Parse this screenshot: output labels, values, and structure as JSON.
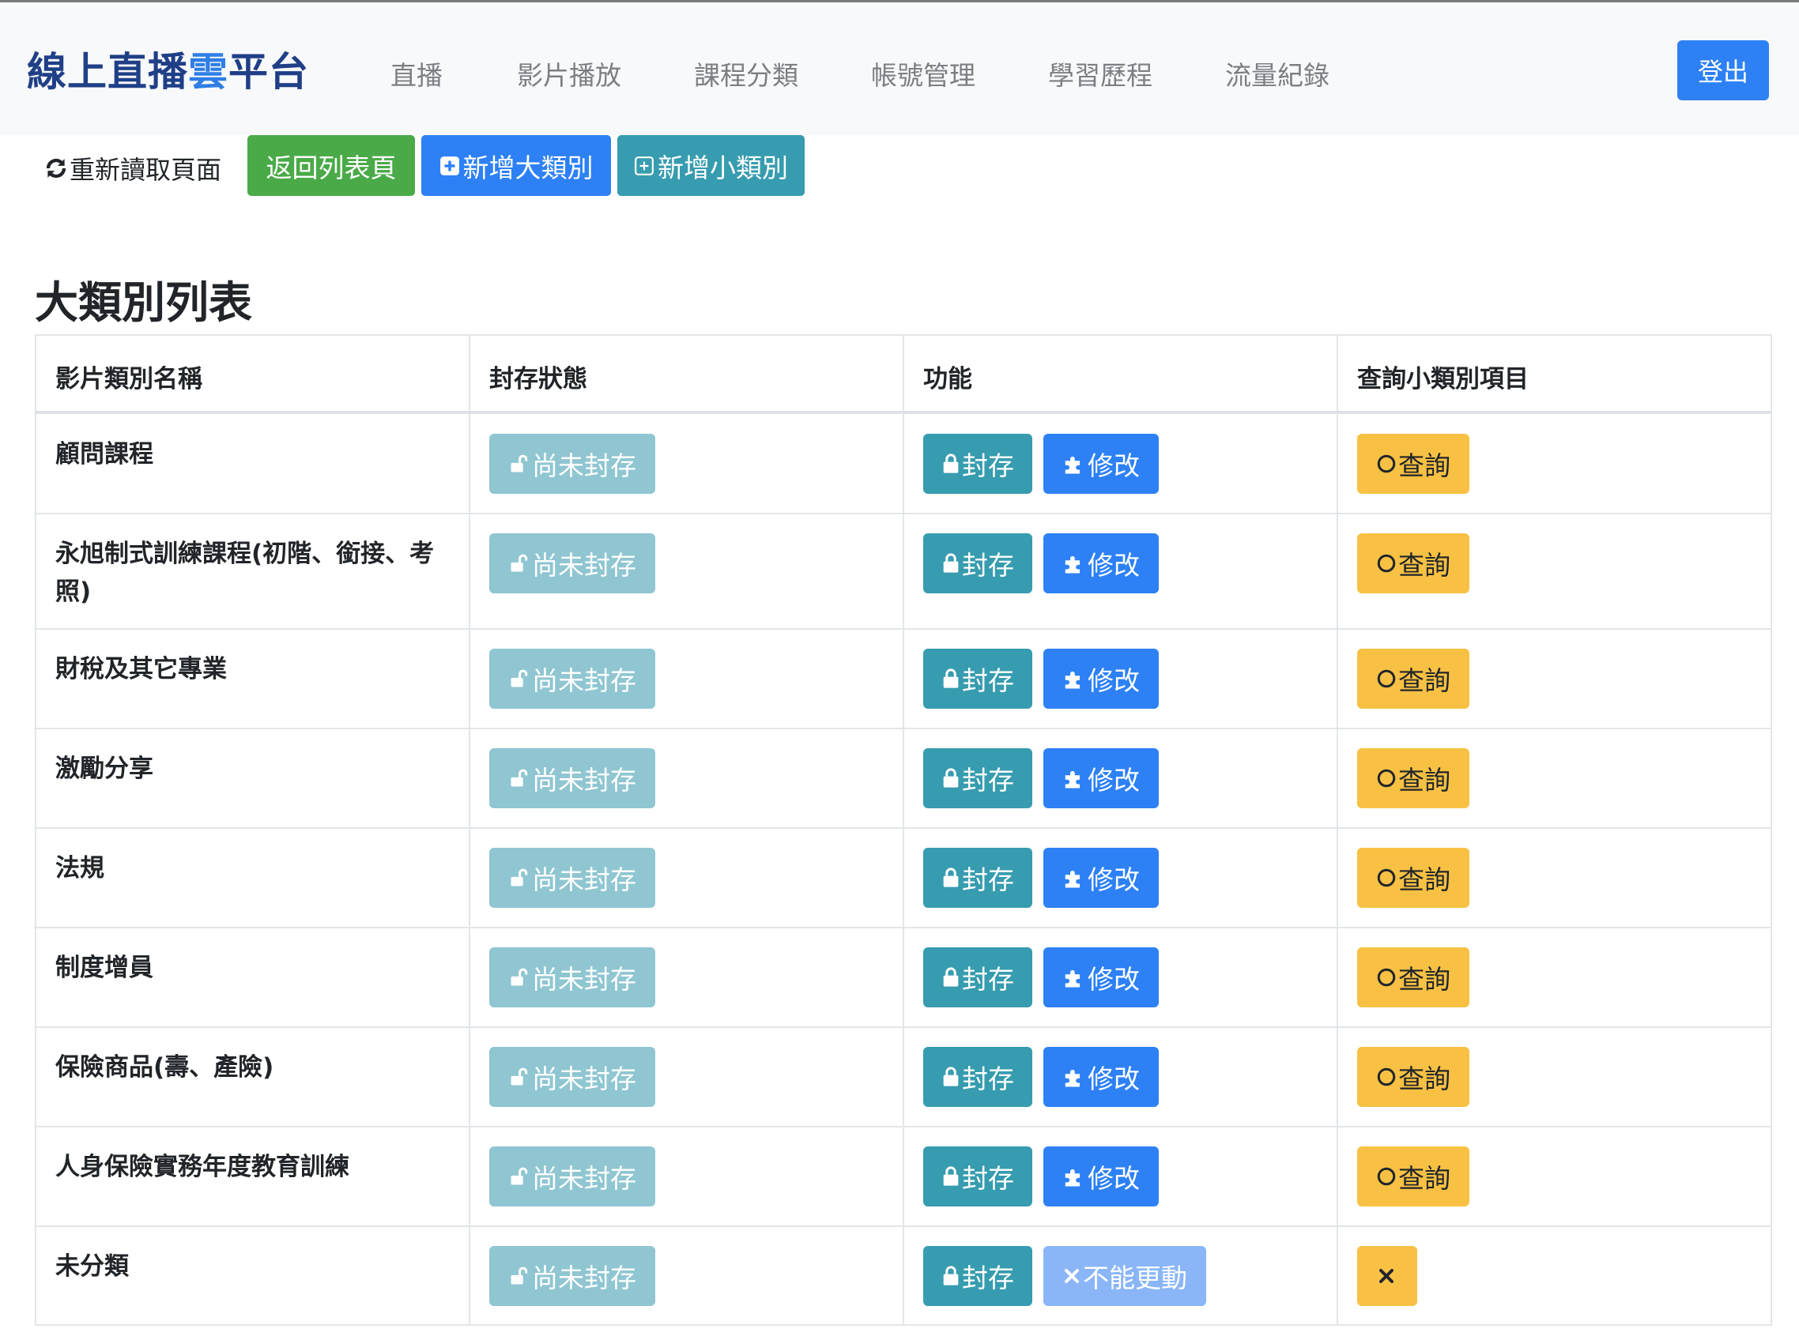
{
  "navbar": {
    "brand_prefix": "線上直播",
    "brand_accent": "雲",
    "brand_suffix": "平台",
    "links": [
      "直播",
      "影片播放",
      "課程分類",
      "帳號管理",
      "學習歷程",
      "流量紀錄"
    ],
    "logout": "登出"
  },
  "toolbar": {
    "reload": "重新讀取頁面",
    "back": "返回列表頁",
    "add_major": "新增大類別",
    "add_minor": "新增小類別"
  },
  "section_title": "大類別列表",
  "table": {
    "headers": [
      "影片類別名稱",
      "封存狀態",
      "功能",
      "查詢小類別項目"
    ],
    "rows": [
      {
        "name": "顧問課程",
        "status": "尚未封存",
        "seal": "封存",
        "edit": "修改",
        "query": "查詢"
      },
      {
        "name": "永旭制式訓練課程(初階、銜接、考照)",
        "status": "尚未封存",
        "seal": "封存",
        "edit": "修改",
        "query": "查詢"
      },
      {
        "name": "財稅及其它專業",
        "status": "尚未封存",
        "seal": "封存",
        "edit": "修改",
        "query": "查詢"
      },
      {
        "name": "激勵分享",
        "status": "尚未封存",
        "seal": "封存",
        "edit": "修改",
        "query": "查詢"
      },
      {
        "name": "法規",
        "status": "尚未封存",
        "seal": "封存",
        "edit": "修改",
        "query": "查詢"
      },
      {
        "name": "制度增員",
        "status": "尚未封存",
        "seal": "封存",
        "edit": "修改",
        "query": "查詢"
      },
      {
        "name": "保險商品(壽、產險)",
        "status": "尚未封存",
        "seal": "封存",
        "edit": "修改",
        "query": "查詢"
      },
      {
        "name": "人身保險實務年度教育訓練",
        "status": "尚未封存",
        "seal": "封存",
        "edit": "修改",
        "query": "查詢"
      },
      {
        "name": "未分類",
        "status": "尚未封存",
        "seal": "封存",
        "edit": "不能更動",
        "query": ""
      }
    ]
  },
  "colors": {
    "primary": "#2d81f5",
    "success": "#4aaa48",
    "info": "#379caf",
    "info_light": "#8fc6d2",
    "warning": "#f8c144",
    "primary_disabled": "#8ab6f8",
    "brand": "#1f3f87"
  },
  "icons": {
    "reload": "refresh-icon",
    "add_major": "plus-square-icon",
    "add_minor": "plus-square-outline-icon",
    "status": "unlock-icon",
    "seal": "lock-icon",
    "edit": "puzzle-icon",
    "query": "circle-icon",
    "noedit": "x-icon"
  }
}
